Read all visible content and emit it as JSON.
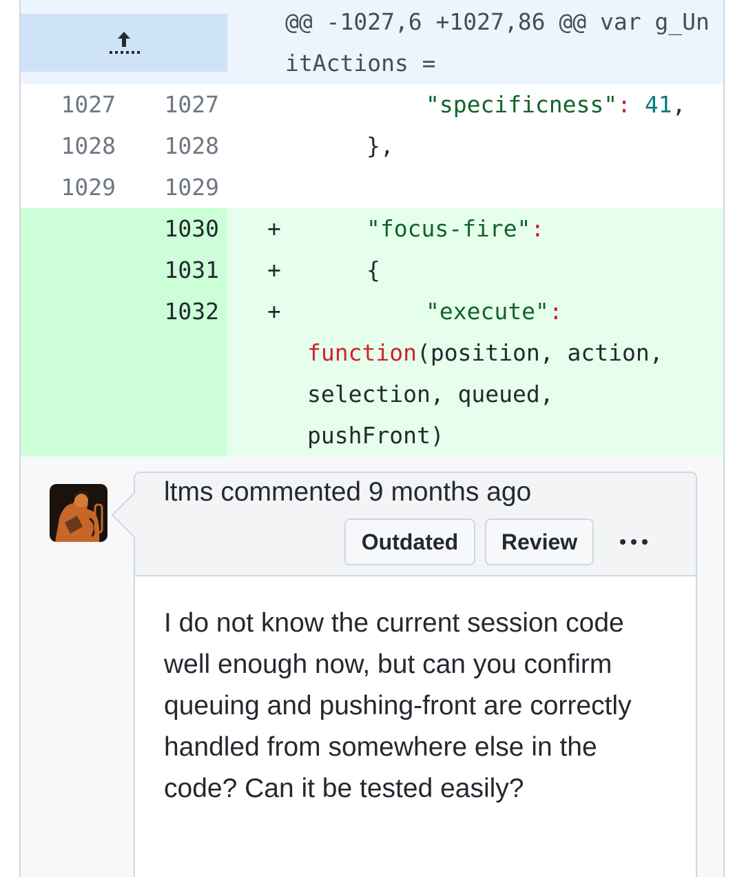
{
  "diff": {
    "hunk_header": "@@ -1027,6 +1027,86 @@ var g_UnitActions =",
    "context_lines": [
      {
        "old": "1027",
        "new": "1027"
      },
      {
        "old": "1028",
        "new": "1028"
      },
      {
        "old": "1029",
        "new": "1029"
      }
    ],
    "line_1027": {
      "key": "\"specificness\"",
      "colon": ":",
      "value": "41",
      "tail": ","
    },
    "line_1028": {
      "text": "},"
    },
    "added_lines": [
      {
        "new": "1030",
        "marker": "+"
      },
      {
        "new": "1031",
        "marker": "+"
      },
      {
        "new": "1032",
        "marker": "+"
      }
    ],
    "line_1030": {
      "key": "\"focus-fire\"",
      "colon": ":"
    },
    "line_1031": {
      "text": "{"
    },
    "line_1032": {
      "key": "\"execute\"",
      "colon": ":"
    },
    "line_1032_cont": {
      "keyword": "function",
      "rest1": "(position, action,",
      "rest2": "selection, queued,",
      "rest3": "pushFront)"
    }
  },
  "comment": {
    "author_line": "ltms commented 9 months ago",
    "outdated_label": "Outdated",
    "review_label": "Review",
    "body": "I do not know the current session code well enough now, but can you confirm queuing and pushing-front are correctly handled from somewhere else in the code? Can it be tested easily?"
  },
  "icons": {
    "expand": "expand-up-icon",
    "more": "kebab-horizontal-icon",
    "avatar": "user-avatar"
  },
  "colors": {
    "added_bg": "#e6ffec",
    "added_gutter": "#ccffd8",
    "hunk_bg": "#ecf4fd",
    "string": "#116329",
    "keyword": "#cf222e"
  }
}
